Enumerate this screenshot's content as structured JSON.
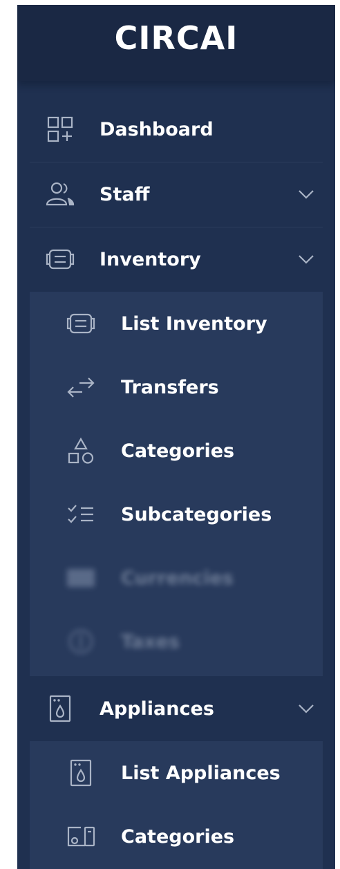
{
  "brand": {
    "name": "CIRCAI"
  },
  "nav": {
    "dashboard": {
      "label": "Dashboard",
      "icon": "dashboard-grid-icon"
    },
    "staff": {
      "label": "Staff",
      "icon": "users-icon"
    },
    "inventory": {
      "label": "Inventory",
      "icon": "box-icon",
      "items": [
        {
          "label": "List Inventory",
          "icon": "box-icon"
        },
        {
          "label": "Transfers",
          "icon": "transfer-arrows-icon"
        },
        {
          "label": "Categories",
          "icon": "shapes-icon"
        },
        {
          "label": "Subcategories",
          "icon": "checklist-icon"
        },
        {
          "label": "Currencies",
          "icon": "banknote-icon"
        },
        {
          "label": "Taxes",
          "icon": "coin-icon"
        }
      ]
    },
    "appliances": {
      "label": "Appliances",
      "icon": "washing-machine-icon",
      "items": [
        {
          "label": "List Appliances",
          "icon": "washing-machine-icon"
        },
        {
          "label": "Categories",
          "icon": "devices-icon"
        }
      ]
    }
  },
  "colors": {
    "sidebar_bg": "#1f3050",
    "brand_bg": "#1a2844",
    "submenu_bg": "#283a5c",
    "text": "#ffffff",
    "icon": "#aab4c6"
  }
}
